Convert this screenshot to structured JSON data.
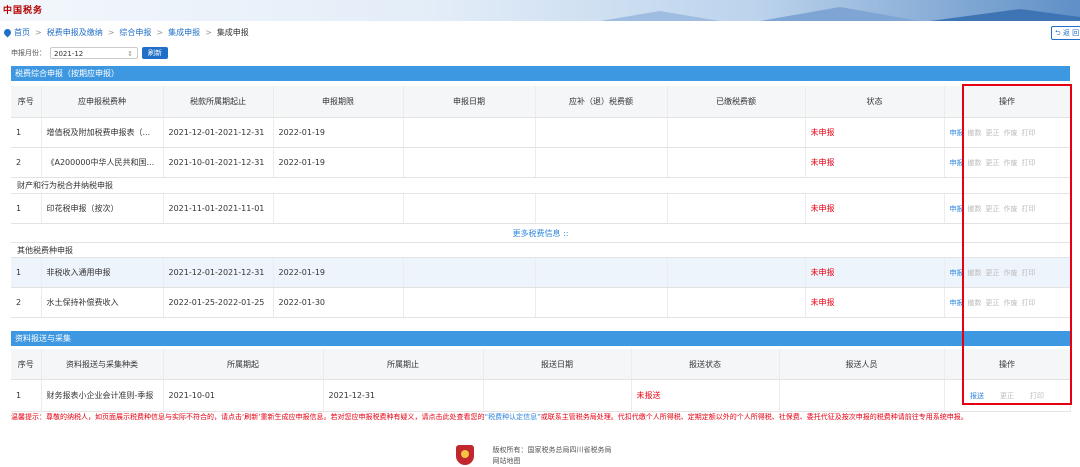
{
  "site": {
    "logo_text": "中国税务"
  },
  "breadcrumb": {
    "items": [
      "首页",
      "税费申报及缴纳",
      "综合申报",
      "集成申报"
    ],
    "current": "集成申报"
  },
  "back_button": {
    "label": "返 回"
  },
  "filter": {
    "label": "申报月份：",
    "value": "2021-12",
    "refresh_label": "刷新"
  },
  "section1": {
    "title": "税费综合申报（按期应申报）",
    "headers": [
      "序号",
      "应申报税费种",
      "税款所属期起止",
      "申报期限",
      "申报日期",
      "应补（退）税费额",
      "已缴税费额",
      "状态",
      "操作"
    ],
    "rows": [
      {
        "no": "1",
        "name": "增值税及附加税费申报表（...",
        "period": "2021-12-01-2021-12-31",
        "deadline": "2022-01-19",
        "date": "",
        "due": "",
        "paid": "",
        "status": "未申报"
      },
      {
        "no": "2",
        "name": "《A200000中华人民共和国...",
        "period": "2021-10-01-2021-12-31",
        "deadline": "2022-01-19",
        "date": "",
        "due": "",
        "paid": "",
        "status": "未申报"
      }
    ],
    "group_label": "财产和行为税合并纳税申报",
    "group_rows": [
      {
        "no": "1",
        "name": "印花税申报（按次）",
        "period": "2021-11-01-2021-11-01",
        "deadline": "",
        "date": "",
        "due": "",
        "paid": "",
        "status": "未申报"
      }
    ],
    "more_link": "更多税费信息 ::",
    "other_label": "其他税费种申报",
    "other_rows": [
      {
        "no": "1",
        "name": "非税收入通用申报",
        "period": "2021-12-01-2021-12-31",
        "deadline": "2022-01-19",
        "date": "",
        "due": "",
        "paid": "",
        "status": "未申报"
      },
      {
        "no": "2",
        "name": "水土保持补偿费收入",
        "period": "2022-01-25-2022-01-25",
        "deadline": "2022-01-30",
        "date": "",
        "due": "",
        "paid": "",
        "status": "未申报"
      }
    ],
    "actions": [
      "申报",
      "撤数",
      "更正",
      "作废",
      "打印"
    ]
  },
  "section2": {
    "title": "资料报送与采集",
    "headers": [
      "序号",
      "资料报送与采集种类",
      "所属期起",
      "所属期止",
      "报送日期",
      "报送状态",
      "报送人员",
      "操作"
    ],
    "rows": [
      {
        "no": "1",
        "name": "财务报表小企业会计准则-季报",
        "start": "2021-10-01",
        "end": "2021-12-31",
        "date": "",
        "status": "未报送",
        "person": ""
      }
    ],
    "actions": [
      "报送",
      "更正",
      "打印"
    ]
  },
  "tip": {
    "text_a": "温馨提示：尊敬的纳税人，如页面展示税费种信息与实际不符合的，请点击‘刷新’重新生成应申报信息。若对您应申报税费种有疑义，请点击此处查看您的",
    "link": "“税费种认定信息”",
    "text_b": "或联系主管税务局处理。代扣代缴个人所得税、定期定额以外的个人所得税、社保费、委托代征及按次申报的税费种请前往专用系统申报。"
  },
  "footer": {
    "copyright": "版权所有：国家税务总局四川省税务局",
    "line2": "网站地图"
  }
}
